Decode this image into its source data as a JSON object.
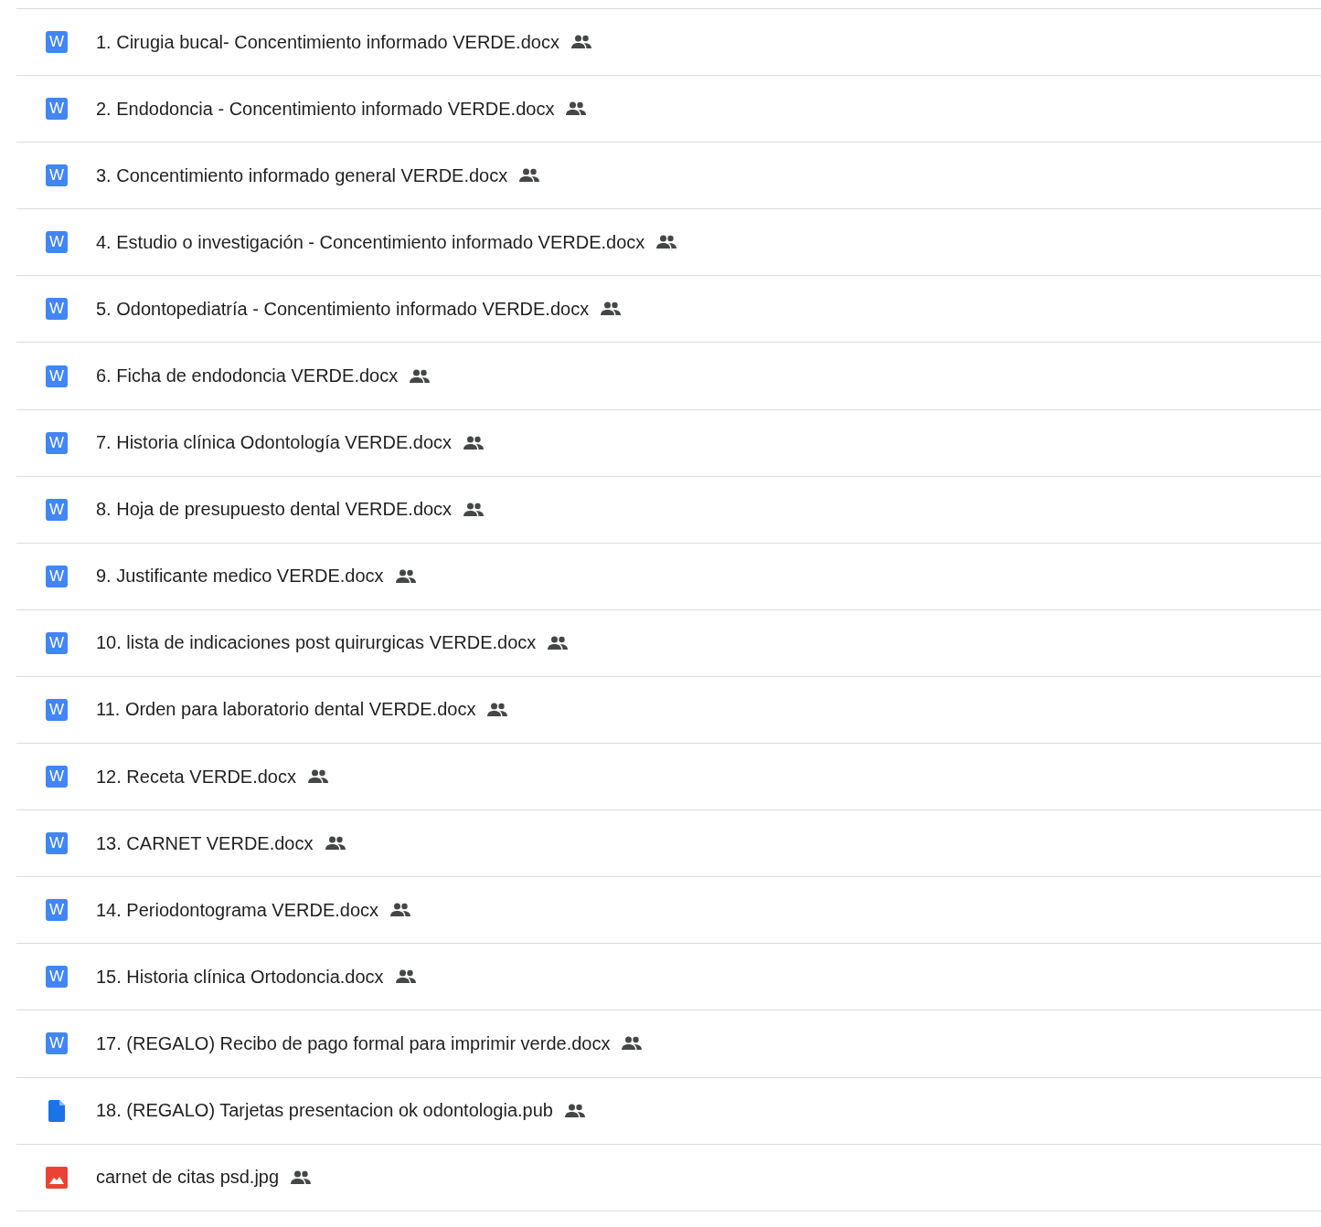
{
  "files": [
    {
      "name": "1. Cirugia bucal- Concentimiento informado VERDE.docx",
      "kind": "word",
      "icon_letter": "W",
      "shared": true
    },
    {
      "name": "2. Endodoncia - Concentimiento informado VERDE.docx",
      "kind": "word",
      "icon_letter": "W",
      "shared": true
    },
    {
      "name": "3. Concentimiento informado general VERDE.docx",
      "kind": "word",
      "icon_letter": "W",
      "shared": true
    },
    {
      "name": "4. Estudio o investigación - Concentimiento informado VERDE.docx",
      "kind": "word",
      "icon_letter": "W",
      "shared": true
    },
    {
      "name": "5. Odontopediatría - Concentimiento informado VERDE.docx",
      "kind": "word",
      "icon_letter": "W",
      "shared": true
    },
    {
      "name": "6. Ficha de endodoncia VERDE.docx",
      "kind": "word",
      "icon_letter": "W",
      "shared": true
    },
    {
      "name": "7. Historia clínica Odontología VERDE.docx",
      "kind": "word",
      "icon_letter": "W",
      "shared": true
    },
    {
      "name": "8. Hoja de presupuesto dental VERDE.docx",
      "kind": "word",
      "icon_letter": "W",
      "shared": true
    },
    {
      "name": "9. Justificante medico VERDE.docx",
      "kind": "word",
      "icon_letter": "W",
      "shared": true
    },
    {
      "name": "10. lista de indicaciones post quirurgicas VERDE.docx",
      "kind": "word",
      "icon_letter": "W",
      "shared": true
    },
    {
      "name": "11. Orden para laboratorio dental VERDE.docx",
      "kind": "word",
      "icon_letter": "W",
      "shared": true
    },
    {
      "name": "12. Receta VERDE.docx",
      "kind": "word",
      "icon_letter": "W",
      "shared": true
    },
    {
      "name": "13. CARNET VERDE.docx",
      "kind": "word",
      "icon_letter": "W",
      "shared": true
    },
    {
      "name": "14. Periodontograma VERDE.docx",
      "kind": "word",
      "icon_letter": "W",
      "shared": true
    },
    {
      "name": "15. Historia clínica Ortodoncia.docx",
      "kind": "word",
      "icon_letter": "W",
      "shared": true
    },
    {
      "name": "17. (REGALO) Recibo de pago formal para imprimir verde.docx",
      "kind": "word",
      "icon_letter": "W",
      "shared": true
    },
    {
      "name": "18. (REGALO) Tarjetas presentacion ok odontologia.pub",
      "kind": "file",
      "shared": true
    },
    {
      "name": "carnet de citas psd.jpg",
      "kind": "image",
      "shared": true
    }
  ]
}
